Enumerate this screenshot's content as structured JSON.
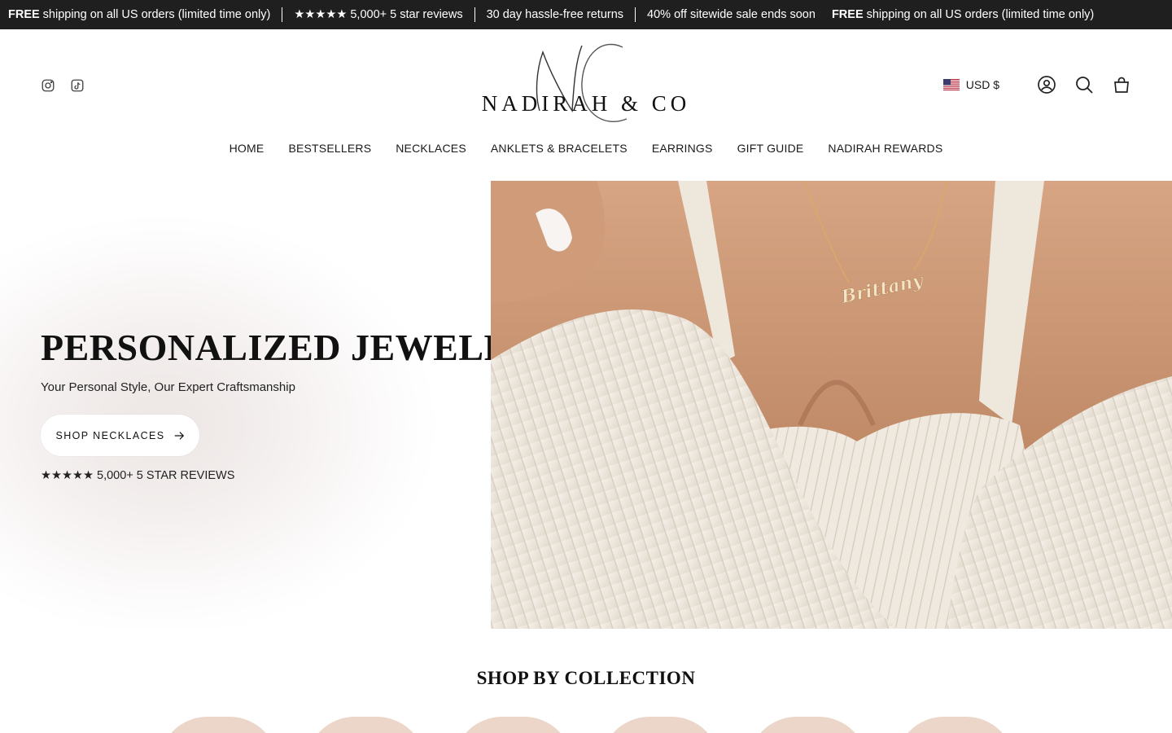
{
  "announcement": {
    "items": [
      {
        "bold": "FREE",
        "text": "shipping on all US orders (limited time only)"
      },
      {
        "bold": "",
        "text": "★★★★★ 5,000+ 5 star reviews"
      },
      {
        "bold": "",
        "text": "30 day hassle-free returns"
      },
      {
        "bold": "",
        "text": "40% off sitewide sale ends soon"
      },
      {
        "bold": "FREE",
        "text": "shipping on all US orders (limited time only)"
      }
    ]
  },
  "header": {
    "social": [
      {
        "icon": "instagram-icon"
      },
      {
        "icon": "tiktok-icon"
      }
    ],
    "logo_monogram": "NC",
    "logo_text": "NADIRAH & CO",
    "currency": "USD $",
    "currency_flag": "us-flag-icon",
    "icons": [
      "account-icon",
      "search-icon",
      "cart-icon"
    ]
  },
  "nav": {
    "items": [
      {
        "label": "HOME"
      },
      {
        "label": "BESTSELLERS"
      },
      {
        "label": "NECKLACES"
      },
      {
        "label": "ANKLETS & BRACELETS"
      },
      {
        "label": "EARRINGS"
      },
      {
        "label": "GIFT GUIDE"
      },
      {
        "label": "NADIRAH REWARDS"
      }
    ]
  },
  "hero": {
    "title": "PERSONALIZED JEWELRY",
    "subtitle": "Your Personal Style, Our Expert Craftsmanship",
    "button_label": "SHOP NECKLACES",
    "reviews": "★★★★★ 5,000+ 5 STAR REVIEWS",
    "necklace_name": "Brittany"
  },
  "collections": {
    "title": "SHOP BY COLLECTION",
    "count": 6
  },
  "colors": {
    "announcement_bg": "#1f1f1f",
    "collection_card": "#ecd6c9",
    "text": "#1a1a1a"
  }
}
